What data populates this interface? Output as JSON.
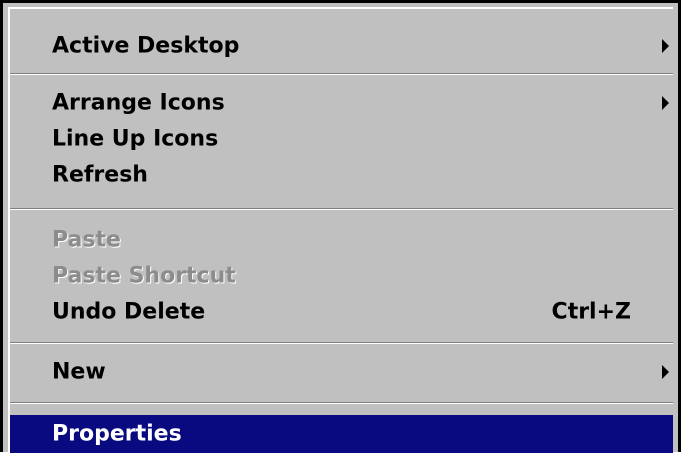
{
  "context_menu": {
    "items": [
      {
        "label": "Active Desktop",
        "has_submenu": true,
        "enabled": true
      },
      {
        "label": "Arrange Icons",
        "has_submenu": true,
        "enabled": true
      },
      {
        "label": "Line Up Icons",
        "enabled": true
      },
      {
        "label": "Refresh",
        "enabled": true
      },
      {
        "label": "Paste",
        "enabled": false
      },
      {
        "label": "Paste Shortcut",
        "enabled": false
      },
      {
        "label": "Undo Delete",
        "shortcut": "Ctrl+Z",
        "enabled": true
      },
      {
        "label": "New",
        "has_submenu": true,
        "enabled": true
      },
      {
        "label": "Properties",
        "enabled": true,
        "highlighted": true
      }
    ]
  },
  "colors": {
    "menu_background": "#c0c0c0",
    "highlight_background": "#0a0a80",
    "highlight_text": "#ffffff",
    "disabled_text": "#8c8c8c"
  }
}
